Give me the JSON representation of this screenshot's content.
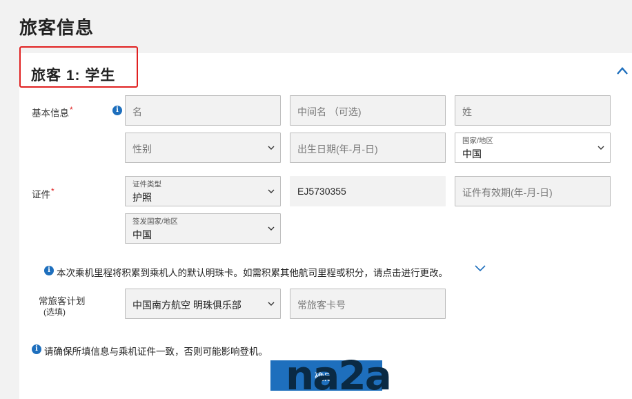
{
  "page": {
    "title": "旅客信息"
  },
  "passenger": {
    "heading": "旅客 1:  学生"
  },
  "basic_info": {
    "label": "基本信息",
    "first_name_placeholder": "名",
    "middle_name_placeholder": "中间名 （可选)",
    "last_name_placeholder": "姓",
    "gender_placeholder": "性别",
    "dob_placeholder": "出生日期(年-月-日)",
    "country_label": "国家/地区",
    "country_value": "中国"
  },
  "document": {
    "label": "证件",
    "type_label": "证件类型",
    "type_value": "护照",
    "number_value": "EJ5730355",
    "expiry_placeholder": "证件有效期(年-月-日)",
    "issuing_country_label": "签发国家/地区",
    "issuing_country_value": "中国"
  },
  "mileage_note": "本次乘机里程将积累到乘机人的默认明珠卡。如需积累其他航司里程或积分，请点击进行更改。",
  "ffp": {
    "label": "常旅客计划",
    "sublabel": "(选填)",
    "program_value": "中国南方航空 明珠俱乐部",
    "card_placeholder": "常旅客卡号"
  },
  "consistency_note": "请确保所填信息与乘机证件一致，否则可能影响登机。",
  "confirm_button": "确定",
  "watermark": "na2a",
  "colors": {
    "accent": "#1e6fbd",
    "required": "#e02020",
    "highlight_box": "#e02020"
  },
  "icons": {
    "info": "info-icon",
    "collapse": "chevron-up-icon",
    "select": "chevron-down-icon",
    "expand_note": "chevron-down-icon"
  }
}
